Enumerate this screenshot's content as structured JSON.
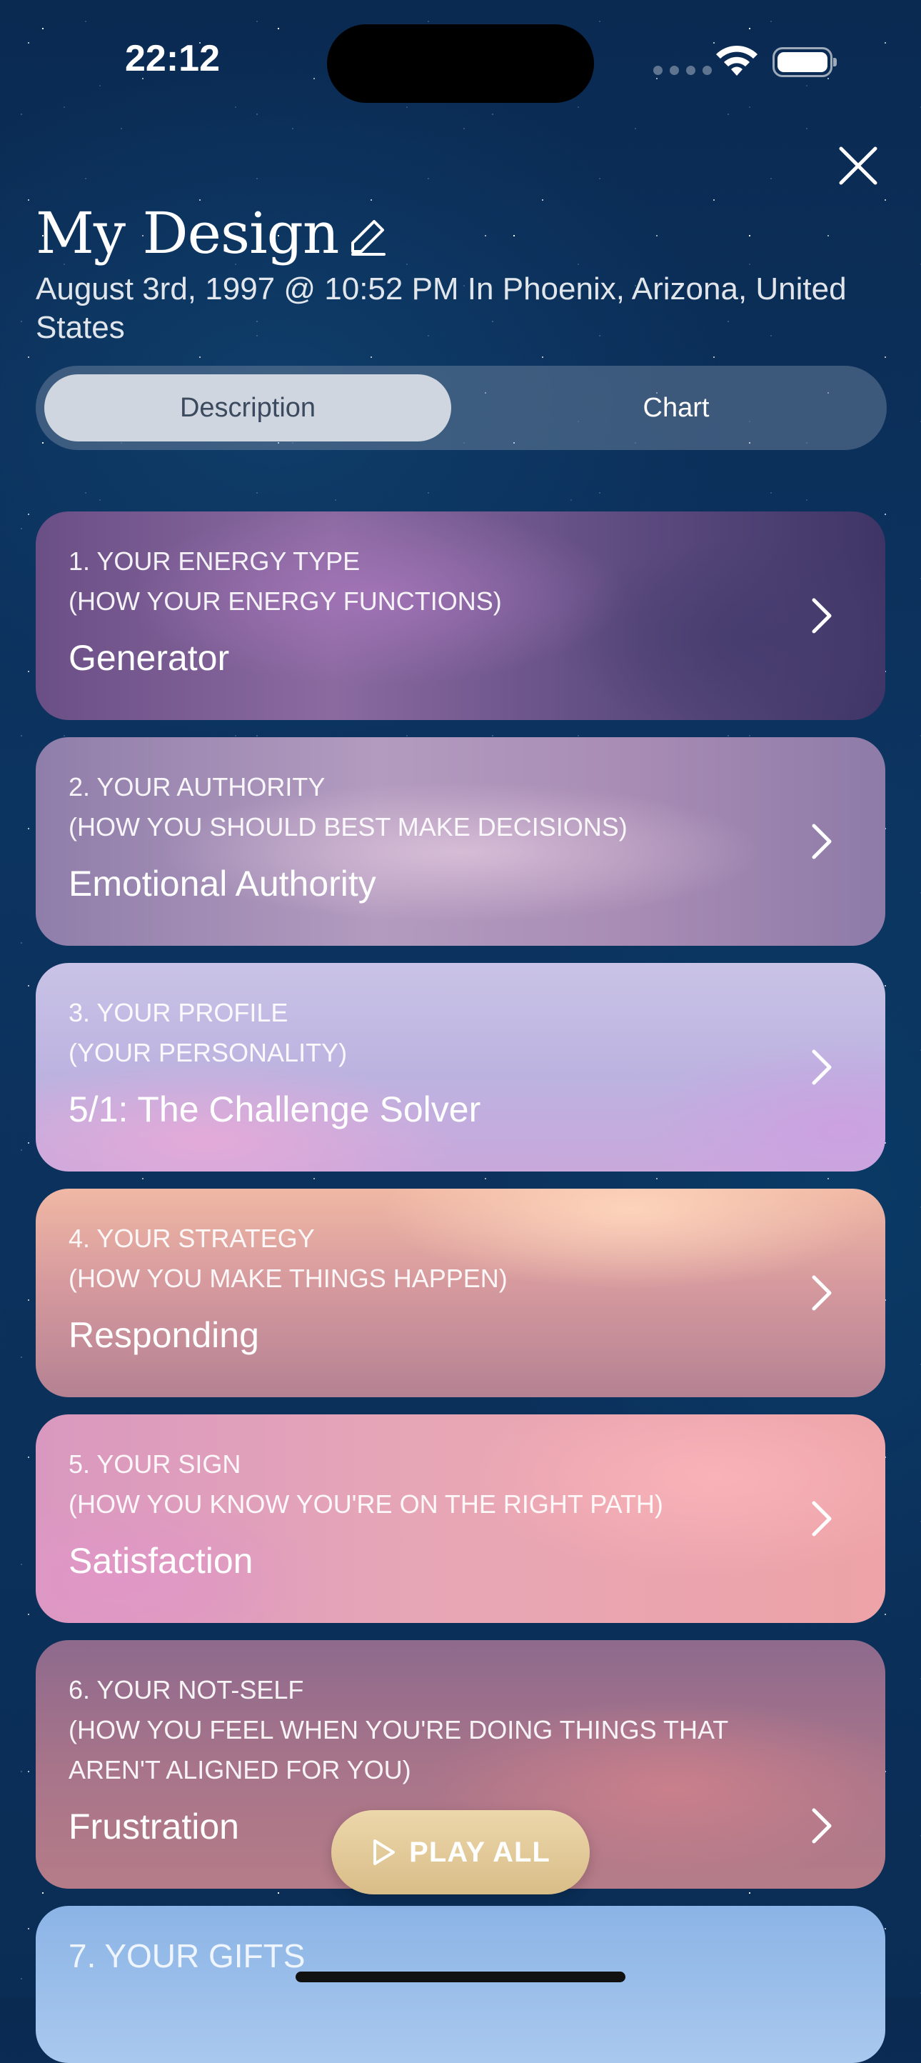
{
  "status_bar": {
    "time": "22:12"
  },
  "header": {
    "title": "My Design",
    "subtitle": "August 3rd, 1997 @ 10:52 PM In Phoenix, Arizona, United States"
  },
  "tabs": [
    {
      "label": "Description",
      "selected": true
    },
    {
      "label": "Chart",
      "selected": false
    }
  ],
  "cards": [
    {
      "label": "1. YOUR ENERGY TYPE\n(HOW YOUR ENERGY FUNCTIONS)",
      "value": "Generator"
    },
    {
      "label": "2. YOUR AUTHORITY\n(HOW YOU SHOULD BEST MAKE DECISIONS)",
      "value": "Emotional Authority"
    },
    {
      "label": "3. YOUR PROFILE\n(YOUR PERSONALITY)",
      "value": "5/1: The Challenge Solver"
    },
    {
      "label": "4. YOUR STRATEGY\n(HOW YOU MAKE THINGS HAPPEN)",
      "value": "Responding"
    },
    {
      "label": "5. YOUR SIGN\n(HOW YOU KNOW YOU'RE ON THE RIGHT PATH)",
      "value": "Satisfaction"
    },
    {
      "label": "6. YOUR NOT-SELF\n(HOW YOU FEEL WHEN YOU'RE DOING THINGS THAT\nAREN'T ALIGNED FOR YOU)",
      "value": "Frustration"
    },
    {
      "label": "7. YOUR GIFTS"
    }
  ],
  "play_all": {
    "label": "PLAY ALL"
  },
  "icons": {
    "close": "close-icon",
    "edit": "pencil-icon",
    "chevron": "chevron-right-icon",
    "play": "play-icon",
    "wifi": "wifi-icon",
    "battery": "battery-icon"
  }
}
